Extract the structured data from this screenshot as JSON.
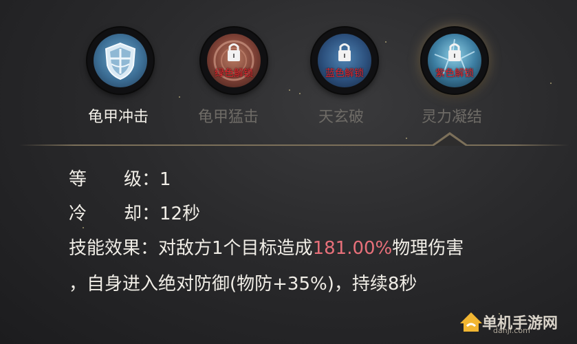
{
  "skills": [
    {
      "name": "龟甲冲击",
      "unlock": "",
      "active": true
    },
    {
      "name": "龟甲猛击",
      "unlock": "绿色解锁",
      "active": false
    },
    {
      "name": "天玄破",
      "unlock": "蓝色解锁",
      "active": false
    },
    {
      "name": "灵力凝结",
      "unlock": "紫色解锁",
      "active": false
    }
  ],
  "details": {
    "level_key": "等",
    "level_key2": "级：",
    "level_value": "1",
    "cooldown_key": "冷",
    "cooldown_key2": "却：",
    "cooldown_value": "12秒",
    "effect_key": "技能效果：",
    "effect_prefix": "对敌方1个目标造成",
    "effect_highlight": "181.00%",
    "effect_suffix": "物理伤害",
    "effect_line2": "，自身进入绝对防御(物防+35%)，持续8秒"
  },
  "watermark": {
    "text": "单机手游网",
    "url": "danji.com"
  },
  "colors": {
    "highlight": "#e8707a",
    "unlock_text": "#e0242c",
    "divider": "#7c705a"
  }
}
